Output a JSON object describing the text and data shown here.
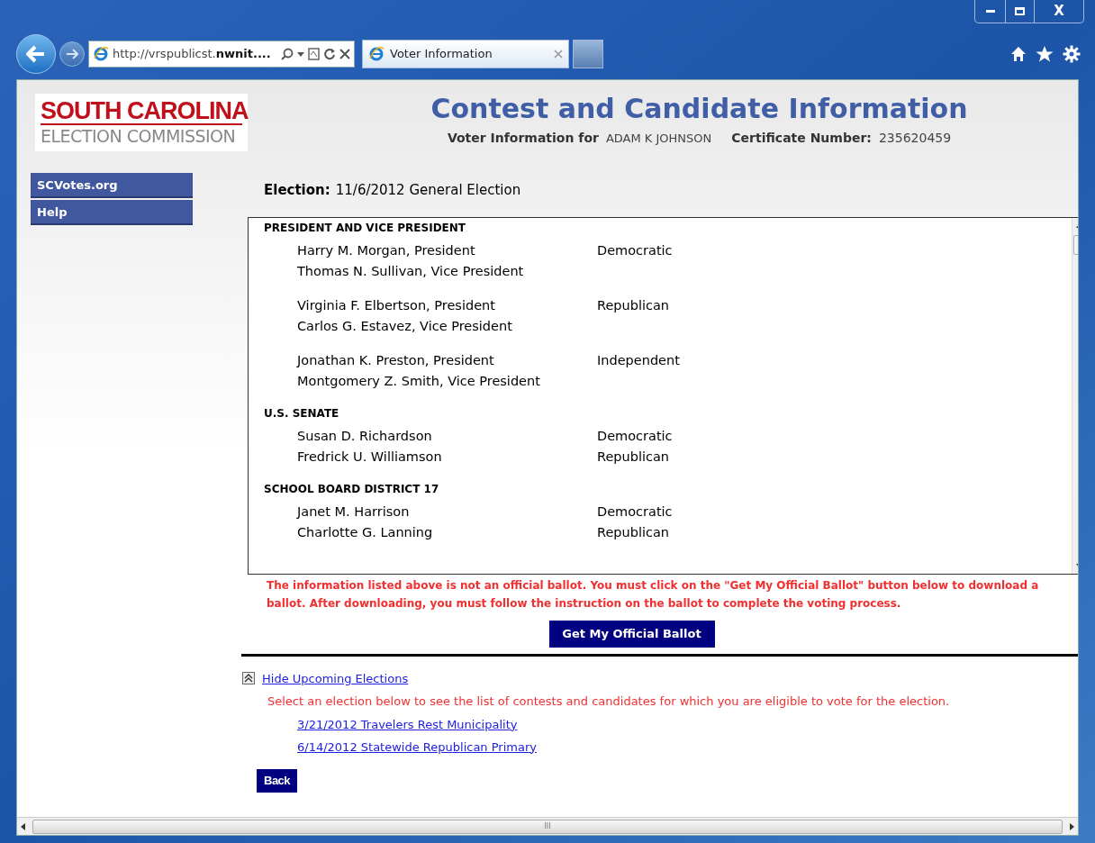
{
  "browser": {
    "address": "http://vrspublicst.",
    "address_bold": "nwnit....",
    "tab_title": "Voter Information",
    "window_buttons": [
      "X"
    ]
  },
  "logo": {
    "line1": "SOUTH CAROLINA",
    "line2": "ELECTION COMMISSION"
  },
  "header": {
    "title": "Contest and Candidate Information",
    "voter_label": "Voter Information for",
    "voter_name": "ADAM K JOHNSON",
    "certificate_label": "Certificate Number:",
    "certificate_number": "235620459"
  },
  "sidebar": {
    "items": [
      {
        "label": "SCVotes.org"
      },
      {
        "label": "Help"
      }
    ]
  },
  "election": {
    "label": "Election:",
    "value": "11/6/2012 General Election"
  },
  "contests": [
    {
      "title": "PRESIDENT AND VICE PRESIDENT",
      "entries": [
        {
          "lines": [
            "Harry M. Morgan, President",
            "Thomas N. Sullivan, Vice President"
          ],
          "party": "Democratic"
        },
        {
          "lines": [
            "Virginia F. Elbertson, President",
            "Carlos G. Estavez, Vice President"
          ],
          "party": "Republican"
        },
        {
          "lines": [
            "Jonathan K. Preston, President",
            "Montgomery Z. Smith, Vice President"
          ],
          "party": "Independent"
        }
      ]
    },
    {
      "title": "U.S. SENATE",
      "entries": [
        {
          "lines": [
            "Susan D. Richardson"
          ],
          "party": "Democratic"
        },
        {
          "lines": [
            "Fredrick U. Williamson"
          ],
          "party": "Republican"
        }
      ]
    },
    {
      "title": "SCHOOL BOARD DISTRICT 17",
      "entries": [
        {
          "lines": [
            "Janet M. Harrison"
          ],
          "party": "Democratic"
        },
        {
          "lines": [
            "Charlotte G. Lanning"
          ],
          "party": "Republican"
        }
      ]
    }
  ],
  "notice": "The information listed above is not an official ballot.  You must click on the \"Get My Official Ballot\" button below to download a ballot.  After downloading, you must follow the instruction on the ballot to complete the voting process.",
  "ballot_button": "Get My Official Ballot",
  "upcoming": {
    "toggle": "Hide Upcoming Elections",
    "expanded": true,
    "instruction": "Select an election below to see the list of contests and candidates for which you are eligible to vote for the election.",
    "elections": [
      "3/21/2012 Travelers Rest Municipality",
      "6/14/2012 Statewide Republican Primary"
    ]
  },
  "back_button": "Back",
  "scrollbar": {
    "grip": "III"
  }
}
